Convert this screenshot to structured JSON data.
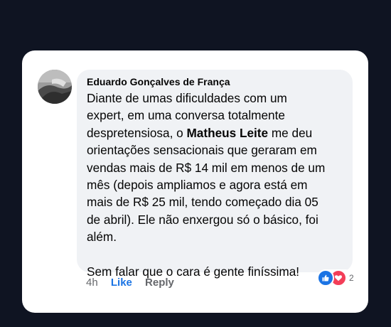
{
  "comment": {
    "author": "Eduardo Gonçalves de França",
    "lines": [
      {
        "type": "text",
        "text": "Diante de umas dificuldades com um"
      },
      {
        "type": "text",
        "text": "expert, em uma conversa totalmente"
      },
      {
        "type": "mention",
        "before": "despretensiosa, o ",
        "mention": "Matheus Leite",
        "after": " me deu"
      },
      {
        "type": "text",
        "text": "orientações sensacionais que geraram em"
      },
      {
        "type": "text",
        "text": "vendas mais de R$ 14 mil em menos de um"
      },
      {
        "type": "text",
        "text": "mês (depois ampliamos e agora está em"
      },
      {
        "type": "text",
        "text": "mais de R$ 25 mil, tendo começado dia 05"
      },
      {
        "type": "text",
        "text": "de abril). Ele não enxergou só o básico, foi"
      },
      {
        "type": "text",
        "text": "além."
      },
      {
        "type": "blank"
      },
      {
        "type": "text",
        "text": "Sem falar que o cara é gente finíssima!"
      }
    ]
  },
  "actions": {
    "time": "4h",
    "like": "Like",
    "reply": "Reply"
  },
  "reactions": {
    "icons": [
      "like-icon",
      "love-icon"
    ],
    "count": "2",
    "colors": {
      "like": "#1b74e4",
      "love": "#f33e58"
    }
  },
  "colors": {
    "background": "#0f1422",
    "card": "#ffffff",
    "bubble": "#f0f2f5",
    "text": "#050505",
    "muted": "#65676b",
    "link": "#1b74e4"
  }
}
